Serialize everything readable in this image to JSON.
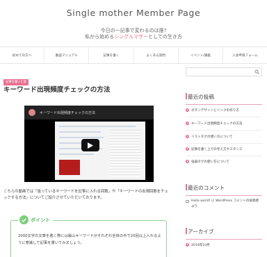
{
  "header": {
    "site_title": "Single mother Member Page",
    "tagline_1": "今日の一記事で変わるのは誰?",
    "tagline_2_pre": "私から始める",
    "tagline_2_highlight": "シングルマザー",
    "tagline_2_post": "としての生き方"
  },
  "nav": {
    "items": [
      "初めての方へ",
      "動画マニュアル",
      "記事を書く",
      "よくある質問",
      "イベント/講義",
      "入会申請フォーム"
    ]
  },
  "post": {
    "category": "記事を書いた後",
    "title": "キーワード出現頻度チェックの方法",
    "video_title": "キーワード出現頻度チェックの方法",
    "body": "こちらの動画では「狙っているキーワードを記事に入れる回数」や「キーワードの出現回数をチェックする方法」についてご紹介させていただいております。",
    "point_label": "ポイント",
    "point_text": "2000文字の文章を書く際には最山キーワードがそれぞれ全体の中で20回以上入れるように意識して記事を書いてみましょう。"
  },
  "sidebar": {
    "recent_posts_title": "最近の投稿",
    "recent_posts": [
      "ボタンデザインとリンクの作り方",
      "キーワード出現頻度チェックの方法",
      "リストタグの使い方について",
      "記事を書く上での考え方やスタンス",
      "強調タグの使い方について"
    ],
    "recent_comments_title": "最近のコメント",
    "recent_comment": "Hello world! に WordPress コメントの投稿者 より",
    "archive_title": "アーカイブ",
    "archive_items": [
      "2019年10月"
    ]
  },
  "colors": {
    "accent": "#e86e8f",
    "point_green": "#7ccf7c"
  }
}
